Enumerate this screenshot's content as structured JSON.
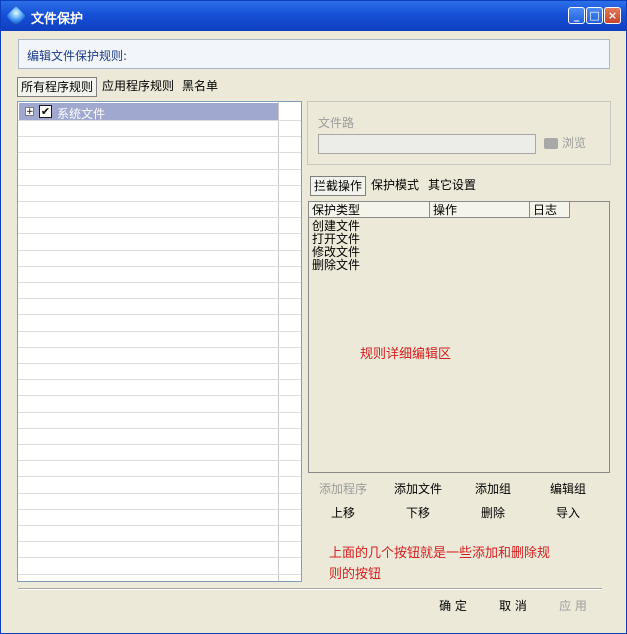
{
  "window": {
    "title": "文件保护",
    "min_glyph": "_",
    "max_glyph": "□",
    "close_glyph": "×"
  },
  "rule_header": "编辑文件保护规则:",
  "left_tabs": [
    "所有程序规则",
    "应用程序规则",
    "黑名单"
  ],
  "tree": {
    "expander": "+",
    "check": "✔",
    "item_label": "系统文件"
  },
  "path": {
    "label": "文件路",
    "input_value": "",
    "browse_label": "浏览"
  },
  "right_tabs": [
    "拦截操作",
    "保护模式",
    "其它设置"
  ],
  "list": {
    "columns": [
      "保护类型",
      "操作",
      "日志"
    ],
    "items": [
      "创建文件",
      "打开文件",
      "修改文件",
      "删除文件"
    ],
    "annotation": "规则详细编辑区"
  },
  "action_buttons": {
    "row1": [
      "添加程序",
      "添加文件",
      "添加组",
      "编辑组"
    ],
    "row2": [
      "上移",
      "下移",
      "删除",
      "导入"
    ]
  },
  "note_text": [
    "上面的几个按钮就是一些添加和删除规",
    "则的按钮"
  ],
  "bottom_buttons": {
    "ok": "确 定",
    "cancel": "取 消",
    "apply": "应 用"
  },
  "colors": {
    "title_bar": "#1750d6",
    "annotation_red": "#d42020",
    "selected_row": "#a0a8d0"
  }
}
